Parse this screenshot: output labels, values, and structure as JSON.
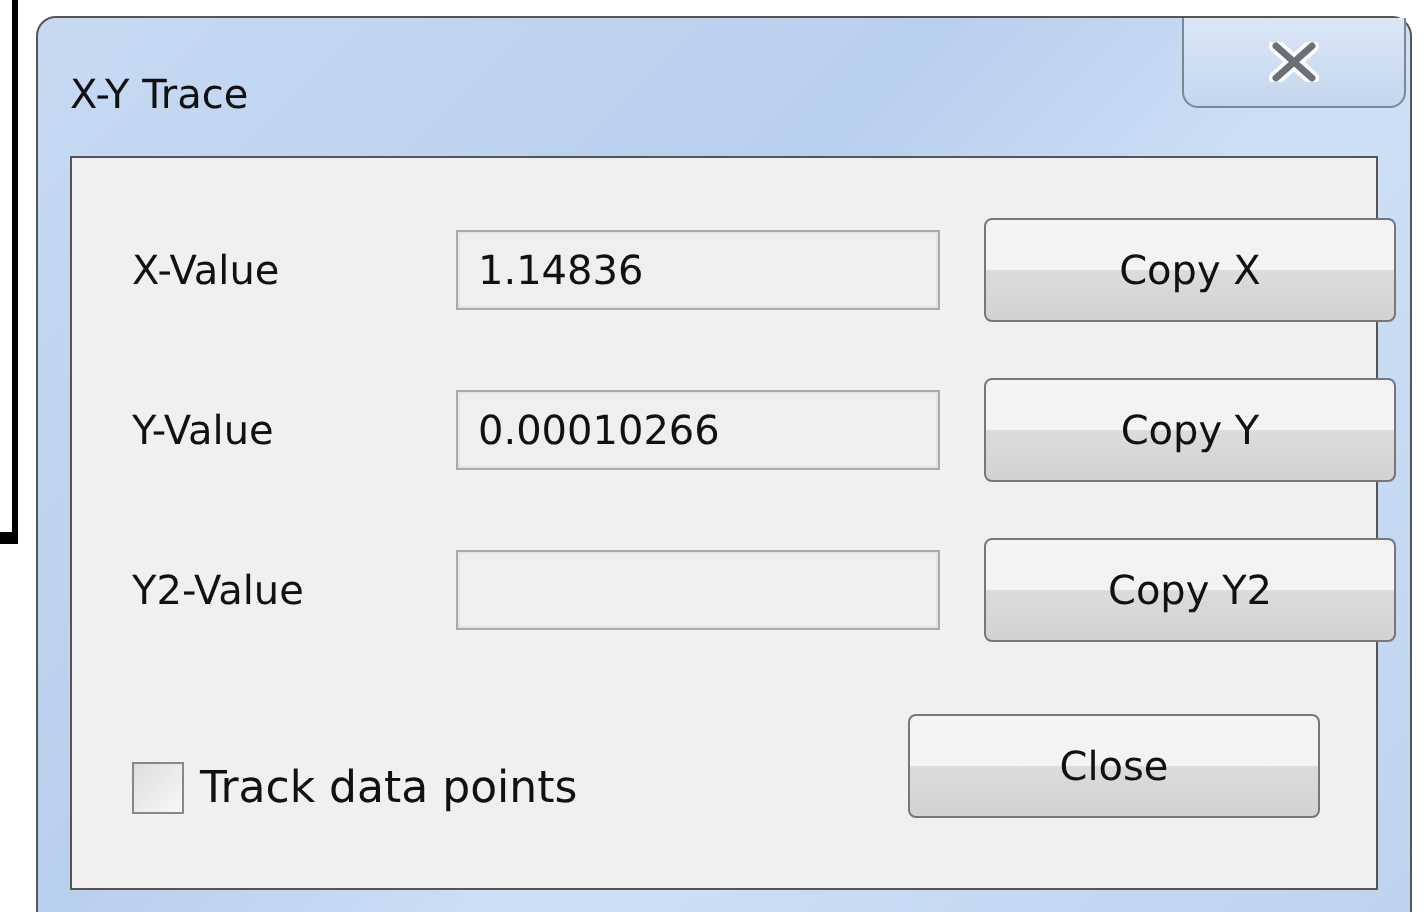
{
  "window": {
    "title": "X-Y Trace"
  },
  "rows": [
    {
      "label": "X-Value",
      "value": "1.14836",
      "button": "Copy X"
    },
    {
      "label": "Y-Value",
      "value": "0.00010266",
      "button": "Copy Y"
    },
    {
      "label": "Y2-Value",
      "value": "",
      "button": "Copy Y2"
    }
  ],
  "track_checkbox": {
    "label": "Track data points",
    "checked": false
  },
  "close_button": "Close"
}
